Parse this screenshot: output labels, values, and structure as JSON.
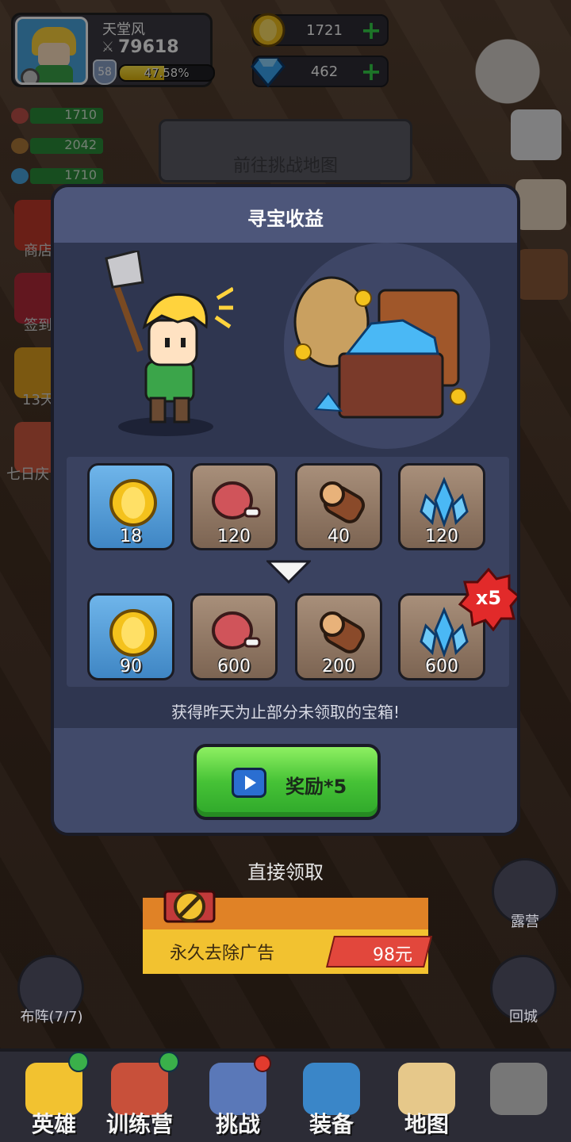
{
  "player": {
    "name": "天堂风",
    "power": "79618",
    "level": "58",
    "xp_percent_text": "47.58%",
    "xp_fraction": 0.4758
  },
  "currencies": [
    {
      "icon": "gold-coin-icon",
      "value": "1721"
    },
    {
      "icon": "diamond-icon",
      "value": "462"
    }
  ],
  "resources": [
    {
      "icon": "meat-icon",
      "value": "1710"
    },
    {
      "icon": "wood-icon",
      "value": "2042"
    },
    {
      "icon": "crystal-icon",
      "value": "1710"
    }
  ],
  "challenge_map_label": "前往挑战地图",
  "side_menu": [
    "商店",
    "签到",
    "13天",
    "七日庆"
  ],
  "dialog": {
    "title": "寻宝收益",
    "base_rewards": [
      {
        "icon": "gold-coin-icon",
        "value": "18",
        "style": "blue"
      },
      {
        "icon": "meat-icon",
        "value": "120",
        "style": "brown"
      },
      {
        "icon": "wood-log-icon",
        "value": "40",
        "style": "brown"
      },
      {
        "icon": "crystal-icon",
        "value": "120",
        "style": "brown"
      }
    ],
    "boosted_rewards": [
      {
        "icon": "gold-coin-icon",
        "value": "90",
        "style": "blue"
      },
      {
        "icon": "meat-icon",
        "value": "600",
        "style": "brown"
      },
      {
        "icon": "wood-log-icon",
        "value": "200",
        "style": "brown"
      },
      {
        "icon": "crystal-icon",
        "value": "600",
        "style": "brown"
      }
    ],
    "multiplier_badge": "x5",
    "note": "获得昨天为止部分未领取的宝箱!",
    "reward_button_label": "奖励*5"
  },
  "direct_claim_label": "直接领取",
  "remove_ads": {
    "label": "永久去除广告",
    "price": "98元"
  },
  "round_buttons": {
    "camp": "露营",
    "formation": "布阵(7/7)",
    "return_city": "回城"
  },
  "bottom_nav": [
    {
      "label": "英雄",
      "icon": "heroes-icon"
    },
    {
      "label": "训练营",
      "icon": "training-camp-icon"
    },
    {
      "label": "挑战",
      "icon": "challenge-sword-icon"
    },
    {
      "label": "装备",
      "icon": "equipment-icon"
    },
    {
      "label": "地图",
      "icon": "map-icon"
    },
    {
      "label": "",
      "icon": "locked-icon"
    }
  ],
  "colors": {
    "accent_green": "#46c236",
    "dialog_bg": "#2f3650",
    "price_red": "#e2473c"
  }
}
